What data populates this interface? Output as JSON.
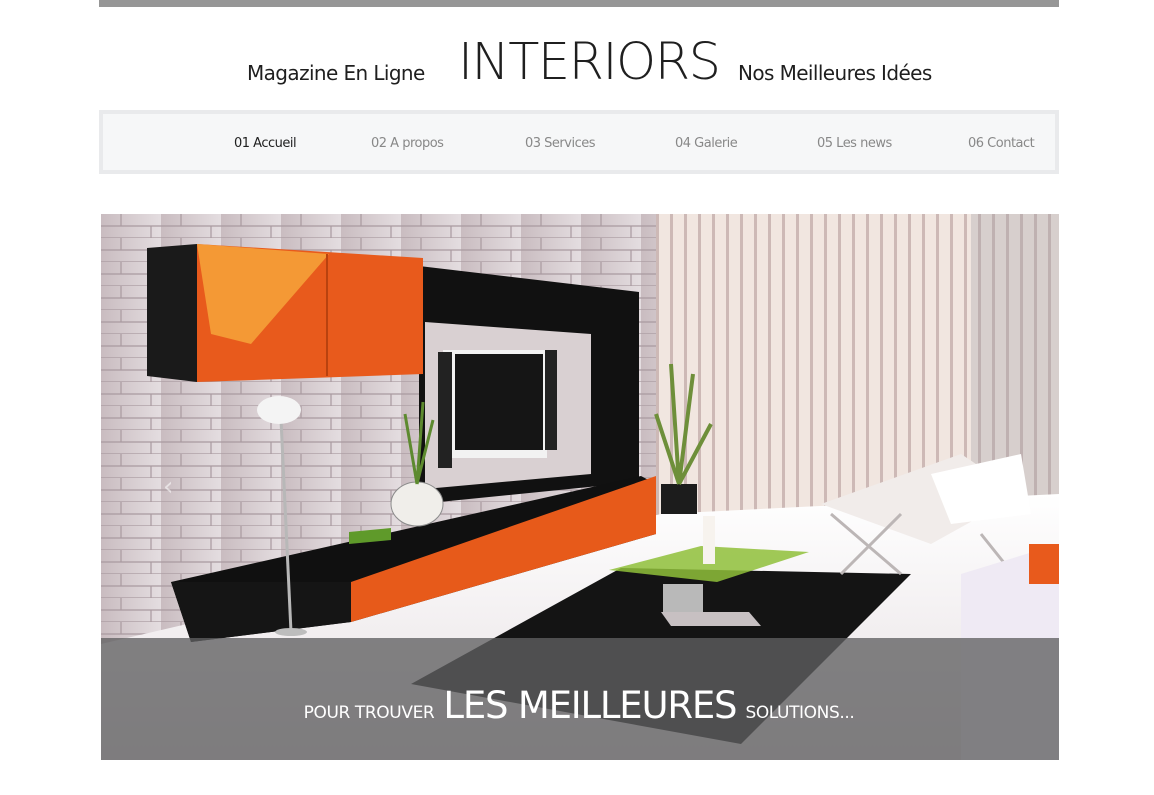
{
  "header": {
    "tagline_left": "Magazine En Ligne",
    "logo": "INTERIORS",
    "tagline_right": "Nos Meilleures Idées"
  },
  "nav": {
    "items": [
      {
        "label": "01 Accueil",
        "active": true
      },
      {
        "label": "02 A propos",
        "active": false
      },
      {
        "label": "03 Services",
        "active": false
      },
      {
        "label": "04 Galerie",
        "active": false
      },
      {
        "label": "05 Les news",
        "active": false
      },
      {
        "label": "06 Contact",
        "active": false
      }
    ]
  },
  "slider": {
    "caption_pre": "POUR TROUVER",
    "caption_main": "LES MEILLEURES",
    "caption_post": "SOLUTIONS...",
    "prev_icon": "chevron-left-icon",
    "image": "living-room-interior-orange-black"
  },
  "colors": {
    "top_bar": "#969696",
    "nav_active": "#1f1f1f",
    "nav_inactive": "#888888",
    "accent_orange": "#e85a1c"
  }
}
